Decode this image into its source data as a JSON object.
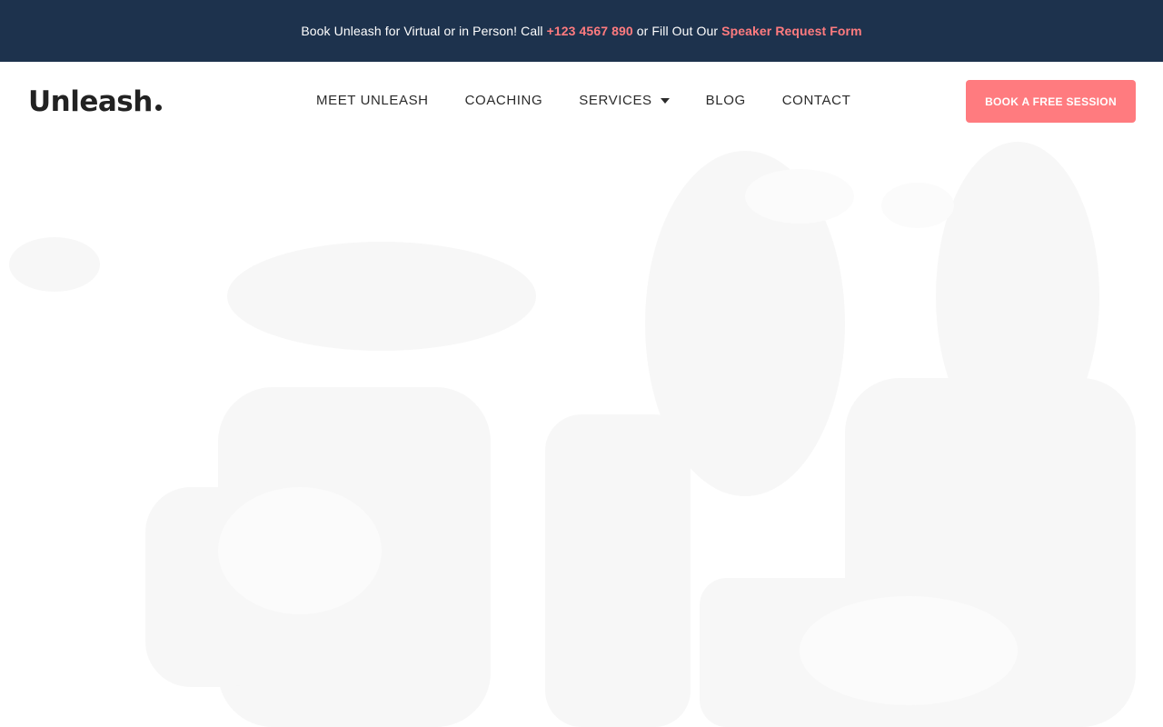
{
  "announcement": {
    "text_1": "Book Unleash for Virtual or in Person! Call ",
    "phone": "+123 4567 890",
    "text_2": " or Fill Out Our ",
    "form_link": "Speaker Request Form"
  },
  "header": {
    "logo": "Unleash",
    "nav": [
      {
        "label": "MEET UNLEASH"
      },
      {
        "label": "COACHING"
      },
      {
        "label": "SERVICES"
      },
      {
        "label": "BLOG"
      },
      {
        "label": "CONTACT"
      }
    ],
    "cta_label": "BOOK A FREE SESSION"
  },
  "colors": {
    "topbar": "#1d324d",
    "accent": "#ff7b7f",
    "text": "#2b2b2b"
  },
  "icons": {
    "services_dropdown": "caret-down-icon"
  }
}
